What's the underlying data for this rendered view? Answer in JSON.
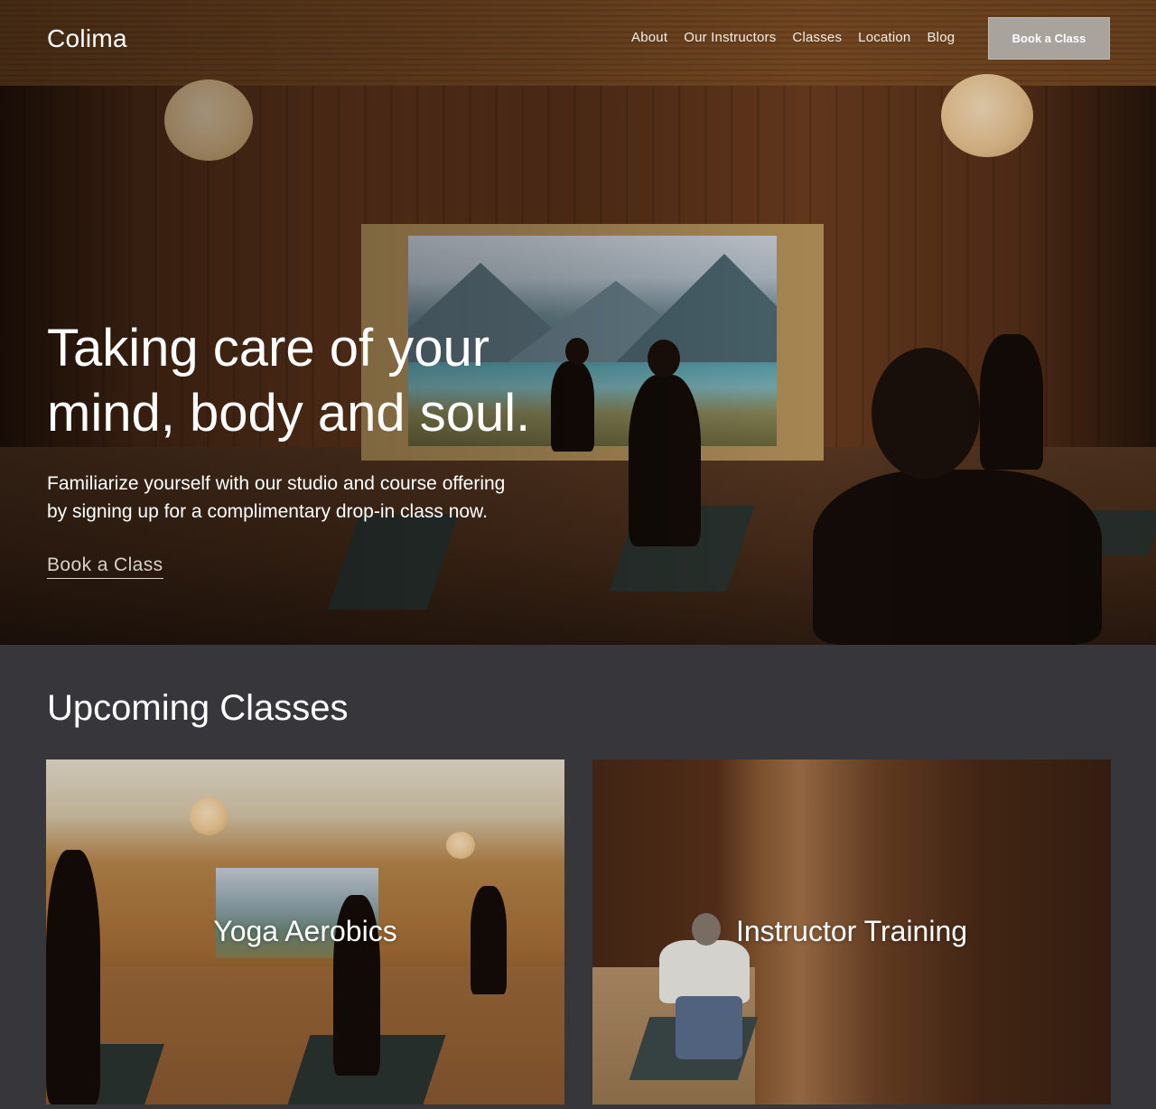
{
  "brand": {
    "logo": "Colima"
  },
  "nav": {
    "items": [
      {
        "label": "About"
      },
      {
        "label": "Our Instructors"
      },
      {
        "label": "Classes"
      },
      {
        "label": "Location"
      },
      {
        "label": "Blog"
      }
    ],
    "cta_label": "Book a Class"
  },
  "hero": {
    "headline_line1": "Taking care of your",
    "headline_line2": "mind, body and soul.",
    "subtext_line1": "Familiarize yourself with our studio and course offering",
    "subtext_line2": "by signing up for a complimentary drop-in class now.",
    "link_label": "Book a Class"
  },
  "upcoming": {
    "title": "Upcoming Classes",
    "cards": [
      {
        "label": "Yoga Aerobics"
      },
      {
        "label": "Instructor Training"
      }
    ]
  },
  "colors": {
    "page_bg": "#37363b",
    "cta_bg": "#a8a39d"
  }
}
